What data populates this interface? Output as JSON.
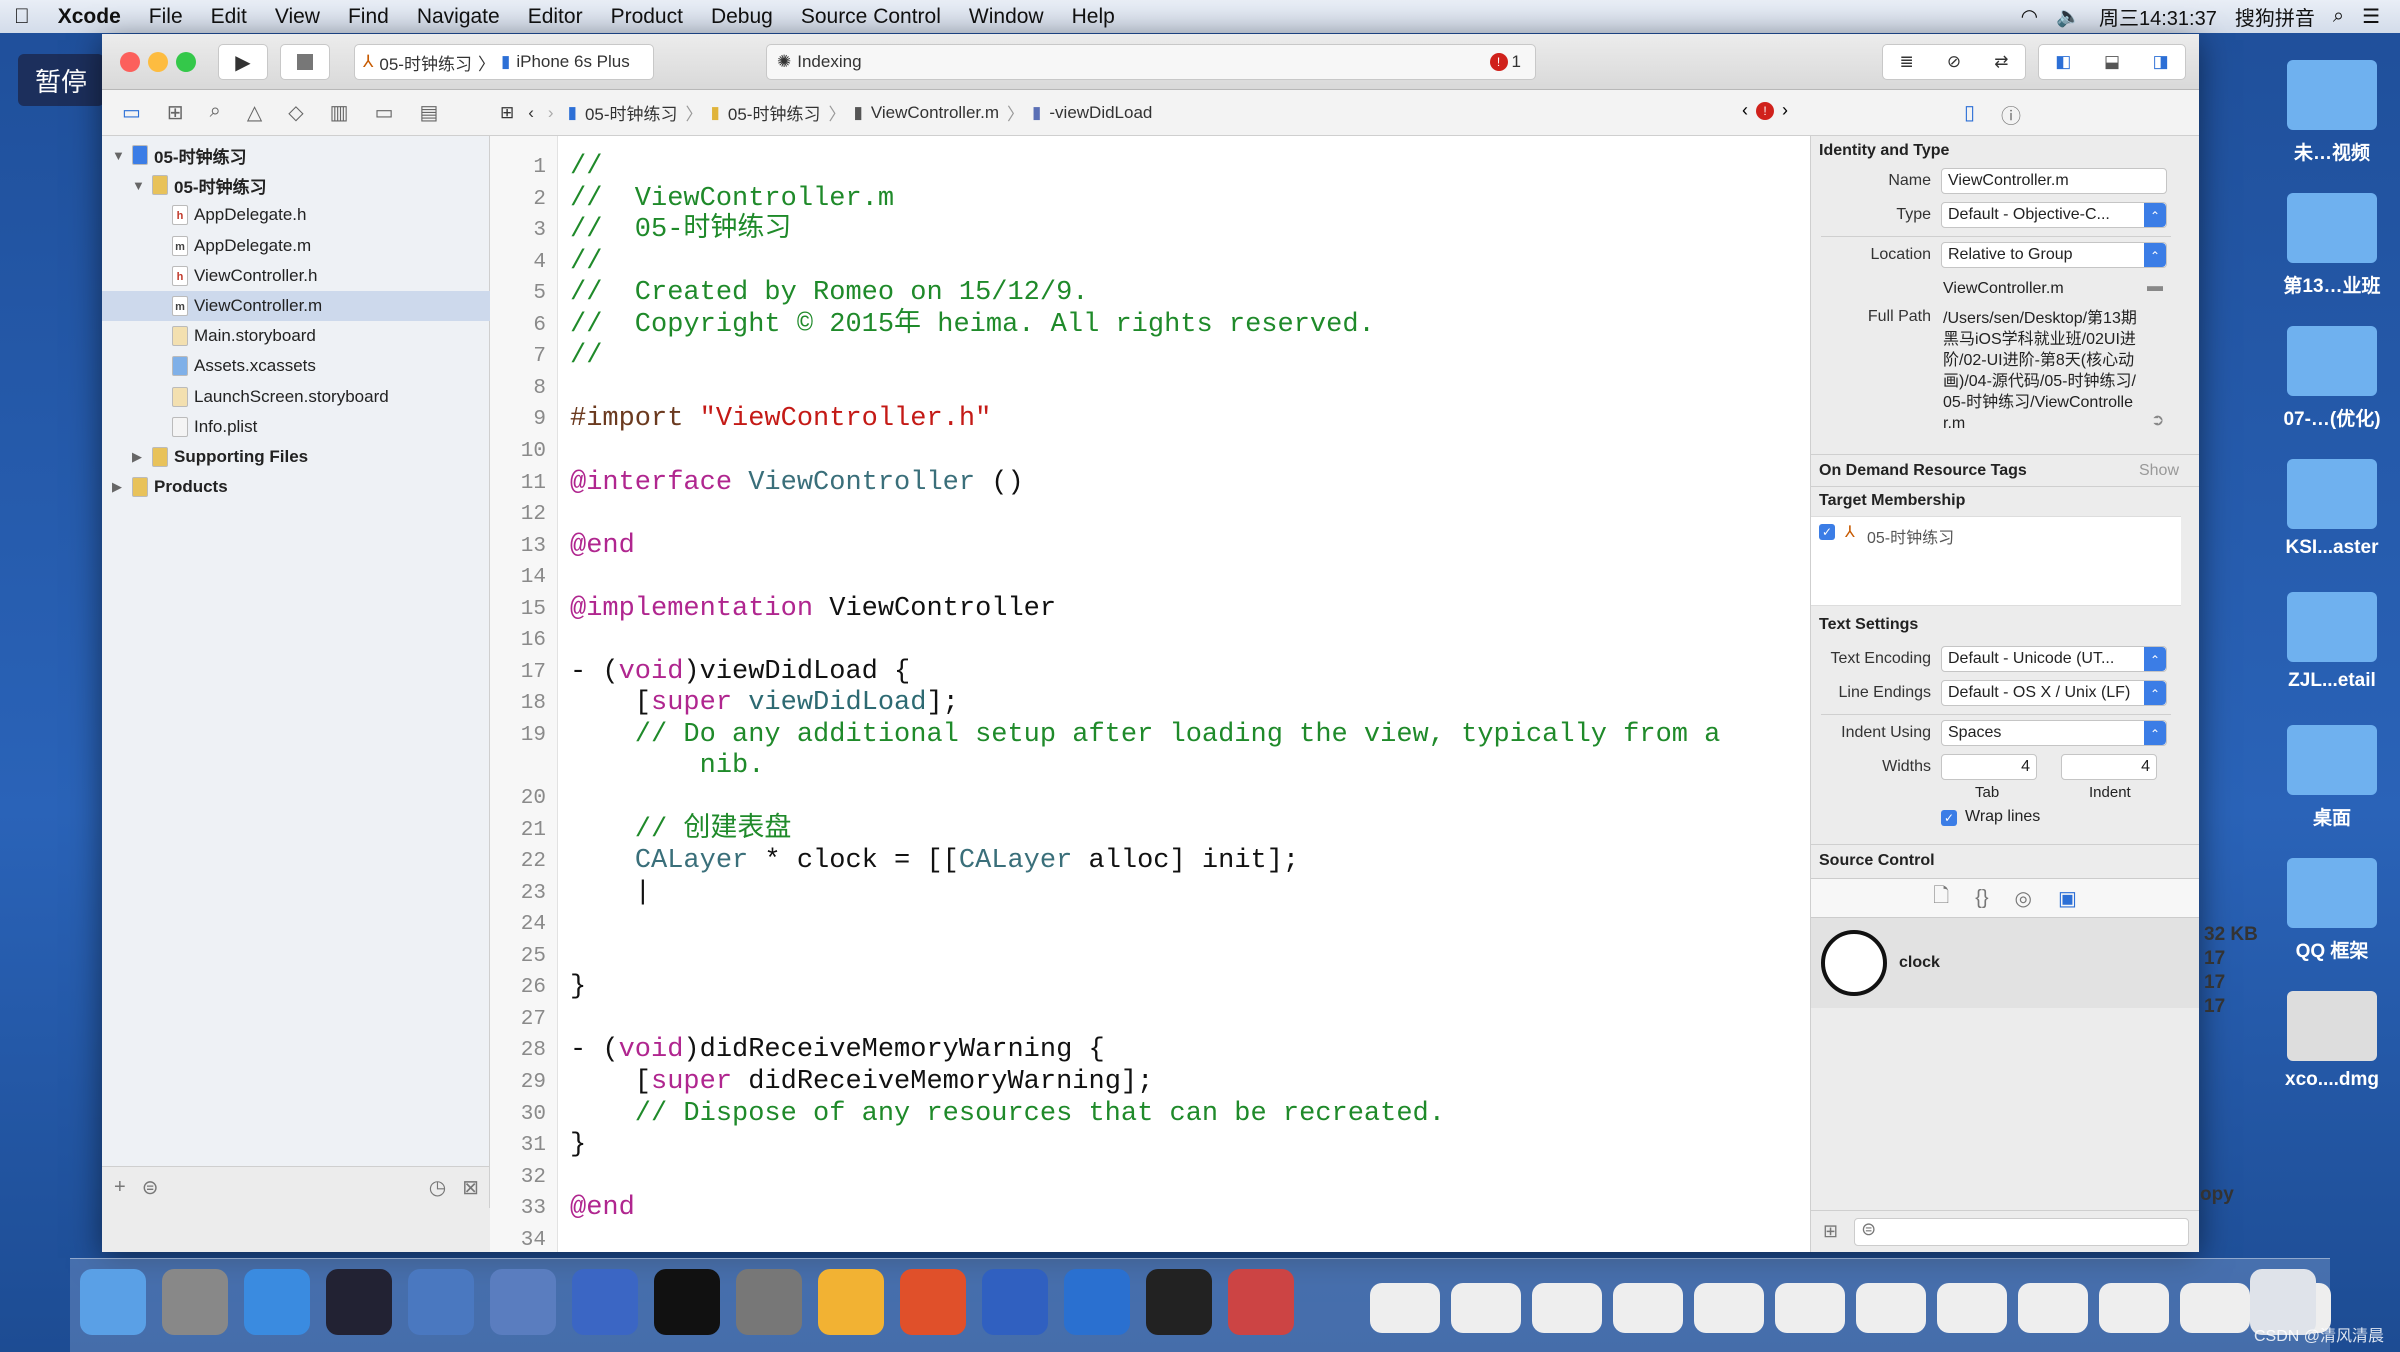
{
  "menubar": {
    "app": "Xcode",
    "items": [
      "File",
      "Edit",
      "View",
      "Find",
      "Navigate",
      "Editor",
      "Product",
      "Debug",
      "Source Control",
      "Window",
      "Help"
    ],
    "clock": "周三14:31:37",
    "ime": "搜狗拼音"
  },
  "overlay": {
    "pause": "暂停"
  },
  "toolbar": {
    "scheme": "05-时钟练习",
    "device": "iPhone 6s Plus",
    "activity": "Indexing",
    "error_count": "1"
  },
  "jumpbar": {
    "items": [
      "05-时钟练习",
      "05-时钟练习",
      "ViewController.m",
      "-viewDidLoad"
    ]
  },
  "navigator": {
    "items": [
      {
        "label": "05-时钟练习",
        "level": 0,
        "icon": "project-icon",
        "disclosure": "open"
      },
      {
        "label": "05-时钟练习",
        "level": 1,
        "icon": "folder-icon",
        "disclosure": "open"
      },
      {
        "label": "AppDelegate.h",
        "level": 2,
        "icon": "h-file-icon"
      },
      {
        "label": "AppDelegate.m",
        "level": 2,
        "icon": "m-file-icon"
      },
      {
        "label": "ViewController.h",
        "level": 2,
        "icon": "h-file-icon"
      },
      {
        "label": "ViewController.m",
        "level": 2,
        "icon": "m-file-icon",
        "selected": true
      },
      {
        "label": "Main.storyboard",
        "level": 2,
        "icon": "storyboard-icon"
      },
      {
        "label": "Assets.xcassets",
        "level": 2,
        "icon": "assets-icon"
      },
      {
        "label": "LaunchScreen.storyboard",
        "level": 2,
        "icon": "storyboard-icon"
      },
      {
        "label": "Info.plist",
        "level": 2,
        "icon": "plist-icon"
      },
      {
        "label": "Supporting Files",
        "level": 1,
        "icon": "folder-icon",
        "disclosure": "closed"
      },
      {
        "label": "Products",
        "level": 0,
        "icon": "folder-icon",
        "disclosure": "closed"
      }
    ]
  },
  "code": [
    {
      "n": "1",
      "s": [
        [
          "c",
          "//"
        ]
      ]
    },
    {
      "n": "2",
      "s": [
        [
          "c",
          "//  ViewController.m"
        ]
      ]
    },
    {
      "n": "3",
      "s": [
        [
          "c",
          "//  05-时钟练习"
        ]
      ]
    },
    {
      "n": "4",
      "s": [
        [
          "c",
          "//"
        ]
      ]
    },
    {
      "n": "5",
      "s": [
        [
          "c",
          "//  Created by Romeo on 15/12/9."
        ]
      ]
    },
    {
      "n": "6",
      "s": [
        [
          "c",
          "//  Copyright © 2015年 heima. All rights reserved."
        ]
      ]
    },
    {
      "n": "7",
      "s": [
        [
          "c",
          "//"
        ]
      ]
    },
    {
      "n": "8",
      "s": []
    },
    {
      "n": "9",
      "s": [
        [
          "p",
          "#import "
        ],
        [
          "s",
          "\"ViewController.h\""
        ]
      ]
    },
    {
      "n": "10",
      "s": []
    },
    {
      "n": "11",
      "s": [
        [
          "k",
          "@interface "
        ],
        [
          "t",
          "ViewController"
        ],
        [
          "n",
          " ()"
        ]
      ]
    },
    {
      "n": "12",
      "s": []
    },
    {
      "n": "13",
      "s": [
        [
          "k",
          "@end"
        ]
      ]
    },
    {
      "n": "14",
      "s": []
    },
    {
      "n": "15",
      "s": [
        [
          "k",
          "@implementation "
        ],
        [
          "n",
          "ViewController"
        ]
      ]
    },
    {
      "n": "16",
      "s": []
    },
    {
      "n": "17",
      "s": [
        [
          "n",
          "- ("
        ],
        [
          "k",
          "void"
        ],
        [
          "n",
          ")viewDidLoad {"
        ]
      ]
    },
    {
      "n": "18",
      "s": [
        [
          "n",
          "    ["
        ],
        [
          "k",
          "super"
        ],
        [
          "n",
          " "
        ],
        [
          "m",
          "viewDidLoad"
        ],
        [
          "n",
          "];"
        ]
      ]
    },
    {
      "n": "19",
      "s": [
        [
          "c",
          "    // Do any additional setup after loading the view, typically from a"
        ]
      ]
    },
    {
      "n": "",
      "s": [
        [
          "c",
          "        nib."
        ]
      ]
    },
    {
      "n": "20",
      "s": []
    },
    {
      "n": "21",
      "s": [
        [
          "c",
          "    // 创建表盘"
        ]
      ]
    },
    {
      "n": "22",
      "s": [
        [
          "n",
          "    "
        ],
        [
          "t",
          "CALayer"
        ],
        [
          "n",
          " * clock = [["
        ],
        [
          "t",
          "CALayer"
        ],
        [
          "n",
          " alloc] init];"
        ]
      ]
    },
    {
      "n": "23",
      "s": [
        [
          "n",
          "    |"
        ]
      ]
    },
    {
      "n": "24",
      "s": []
    },
    {
      "n": "25",
      "s": []
    },
    {
      "n": "26",
      "s": [
        [
          "n",
          "}"
        ]
      ]
    },
    {
      "n": "27",
      "s": []
    },
    {
      "n": "28",
      "s": [
        [
          "n",
          "- ("
        ],
        [
          "k",
          "void"
        ],
        [
          "n",
          ")didReceiveMemoryWarning {"
        ]
      ]
    },
    {
      "n": "29",
      "s": [
        [
          "n",
          "    ["
        ],
        [
          "k",
          "super"
        ],
        [
          "n",
          " didReceiveMemoryWarning];"
        ]
      ]
    },
    {
      "n": "30",
      "s": [
        [
          "c",
          "    // Dispose of any resources that can be recreated."
        ]
      ]
    },
    {
      "n": "31",
      "s": [
        [
          "n",
          "}"
        ]
      ]
    },
    {
      "n": "32",
      "s": []
    },
    {
      "n": "33",
      "s": [
        [
          "k",
          "@end"
        ]
      ]
    },
    {
      "n": "34",
      "s": []
    }
  ],
  "inspector": {
    "identity_header": "Identity and Type",
    "name_label": "Name",
    "name_value": "ViewController.m",
    "type_label": "Type",
    "type_value": "Default - Objective-C...",
    "location_label": "Location",
    "location_value": "Relative to Group",
    "location_file": "ViewController.m",
    "fullpath_label": "Full Path",
    "fullpath_value": "/Users/sen/Desktop/第13期黑马iOS学科就业班/02UI进阶/02-UI进阶-第8天(核心动画)/04-源代码/05-时钟练习/05-时钟练习/ViewController.m",
    "odr_header": "On Demand Resource Tags",
    "odr_show": "Show",
    "target_header": "Target Membership",
    "target_item": "05-时钟练习",
    "target_checked": true,
    "text_header": "Text Settings",
    "encoding_label": "Text Encoding",
    "encoding_value": "Default - Unicode (UT...",
    "endings_label": "Line Endings",
    "endings_value": "Default - OS X / Unix (LF)",
    "indent_label": "Indent Using",
    "indent_value": "Spaces",
    "widths_label": "Widths",
    "tab_value": "4",
    "indent_value_num": "4",
    "tab_label": "Tab",
    "indent_sub_label": "Indent",
    "wrap_label": "Wrap lines",
    "wrap_checked": true,
    "sc_header": "Source Control",
    "library_item": "clock"
  },
  "desktop": {
    "items": [
      "未…视频",
      "第13…业班",
      "07-…(优化)",
      "KSI...aster",
      "ZJL...etail",
      "桌面",
      "QQ 框架",
      "xco....dmg"
    ],
    "behind_text": [
      "32 KB",
      "17",
      "17",
      "17",
      "opy"
    ],
    "watermark": "CSDN @清风清晨"
  }
}
